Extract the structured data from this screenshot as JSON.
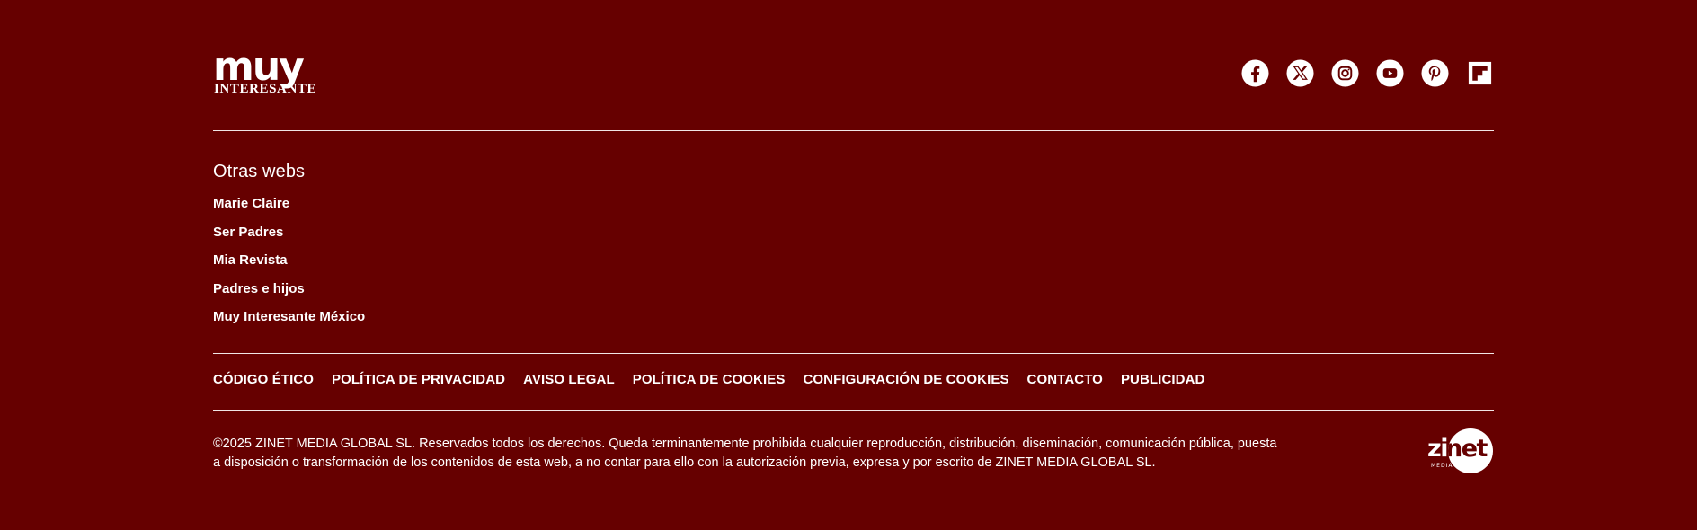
{
  "brand": {
    "logo_top": "muy",
    "logo_bottom": "INTERESANTE",
    "background_color": "#660000",
    "text_color": "#ffffff"
  },
  "social": [
    {
      "name": "facebook-icon",
      "label": "Facebook"
    },
    {
      "name": "x-icon",
      "label": "X"
    },
    {
      "name": "instagram-icon",
      "label": "Instagram"
    },
    {
      "name": "youtube-icon",
      "label": "YouTube"
    },
    {
      "name": "pinterest-icon",
      "label": "Pinterest"
    },
    {
      "name": "flipboard-icon",
      "label": "Flipboard"
    }
  ],
  "otras_webs": {
    "title": "Otras webs",
    "items": [
      "Marie Claire",
      "Ser Padres",
      "Mia Revista",
      "Padres e hijos",
      "Muy Interesante México"
    ]
  },
  "legal_links": [
    "CÓDIGO ÉTICO",
    "POLÍTICA DE PRIVACIDAD",
    "AVISO LEGAL",
    "POLÍTICA DE COOKIES",
    "CONFIGURACIÓN DE COOKIES",
    "CONTACTO",
    "PUBLICIDAD"
  ],
  "copyright": {
    "line1": "©2025 ZINET MEDIA GLOBAL SL. Reservados todos los derechos. Queda terminantemente prohibida cualquier reproducción, distribución, diseminación, comunicación pública, puesta",
    "line2": "a disposición o transformación de los contenidos de esta web, a no contar para ello con la autorización previa, expresa y por escrito de ZINET MEDIA GLOBAL SL."
  },
  "publisher_logo": {
    "word": "zinet",
    "sub": "MEDIA GROUP"
  }
}
